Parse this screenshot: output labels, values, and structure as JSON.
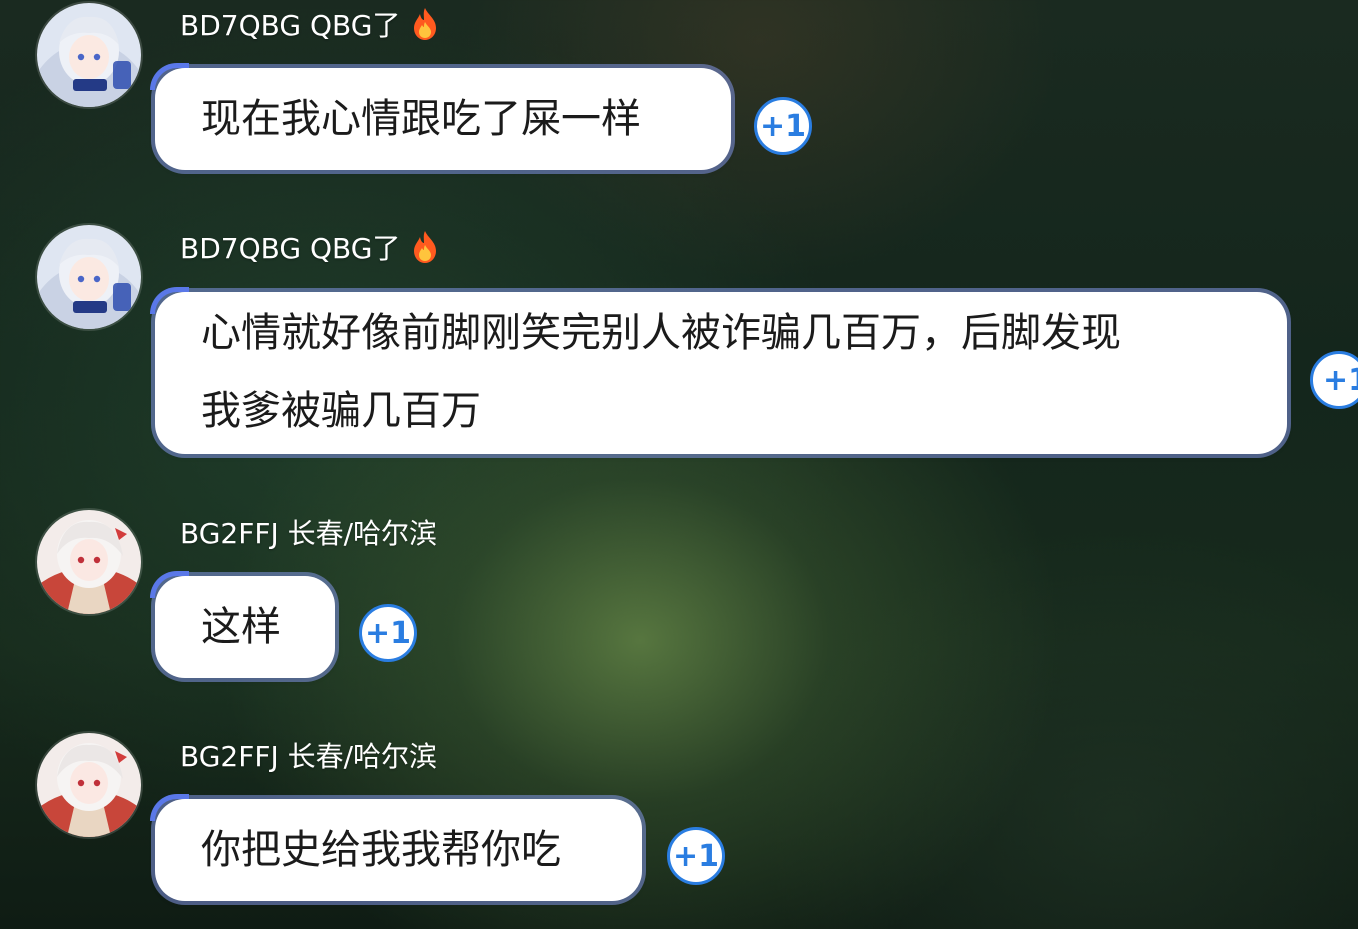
{
  "messages": [
    {
      "sender": "BD7QBG QBG了",
      "badge_icon": "fire-icon",
      "avatar_icon": "silver-hair-girl-avatar-icon",
      "text": "现在我心情跟吃了屎一样",
      "plus_one_label": "+1"
    },
    {
      "sender": "BD7QBG QBG了",
      "badge_icon": "fire-icon",
      "avatar_icon": "silver-hair-girl-avatar-icon",
      "text_line1": "心情就好像前脚刚笑完别人被诈骗几百万，后脚发现",
      "text_line2": "我爹被骗几百万",
      "plus_one_label": "+1"
    },
    {
      "sender": "BG2FFJ 长春/哈尔滨",
      "avatar_icon": "white-hair-girl-avatar-icon",
      "text": "这样",
      "plus_one_label": "+1"
    },
    {
      "sender": "BG2FFJ 长春/哈尔滨",
      "avatar_icon": "white-hair-girl-avatar-icon",
      "text": "你把史给我我帮你吃",
      "plus_one_label": "+1"
    }
  ],
  "colors": {
    "accent": "#2a7de1",
    "bubble": "#ffffff",
    "bubble_accent": "#5a78e8",
    "fire": "#ff5a1f"
  }
}
